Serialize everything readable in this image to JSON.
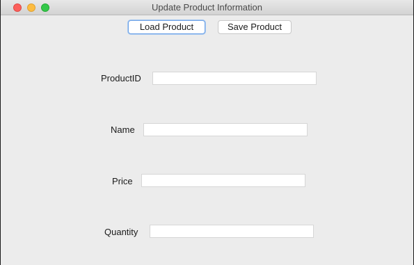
{
  "window": {
    "title": "Update Product Information"
  },
  "toolbar": {
    "load_label": "Load Product",
    "save_label": "Save Product"
  },
  "form": {
    "product_id": {
      "label": "ProductID",
      "value": "",
      "placeholder": ""
    },
    "name": {
      "label": "Name",
      "value": "",
      "placeholder": ""
    },
    "price": {
      "label": "Price",
      "value": "",
      "placeholder": ""
    },
    "quantity": {
      "label": "Quantity",
      "value": "",
      "placeholder": ""
    }
  },
  "colors": {
    "window_bg": "#ececec",
    "close": "#fc605c",
    "minimize": "#fdbc40",
    "maximize": "#34c84a",
    "focus_ring": "#6ea3e6"
  }
}
